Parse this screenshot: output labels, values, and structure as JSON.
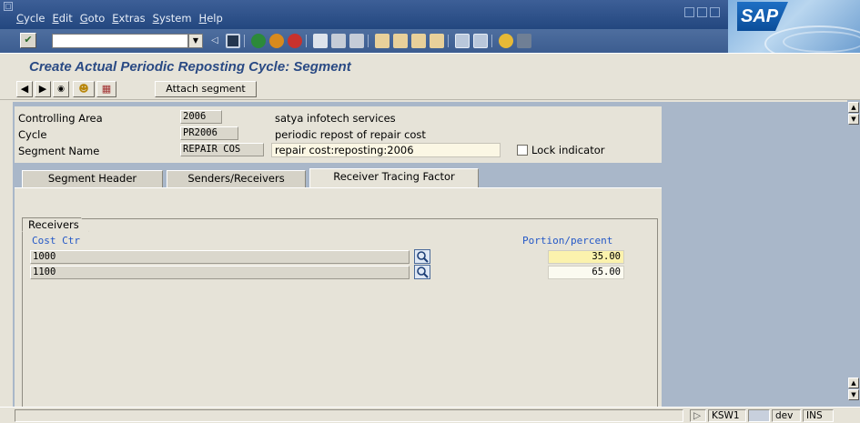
{
  "menu": [
    "Cycle",
    "Edit",
    "Goto",
    "Extras",
    "System",
    "Help"
  ],
  "logo": "SAP",
  "title": "Create Actual Periodic Reposting Cycle: Segment",
  "app_toolbar": {
    "attach_label": "Attach segment"
  },
  "header": {
    "controlling_area": {
      "label": "Controlling Area",
      "value": "2006",
      "desc": "satya infotech  services"
    },
    "cycle": {
      "label": "Cycle",
      "value": "PR2006",
      "desc": "periodic repost of repair cost"
    },
    "segment_name": {
      "label": "Segment Name",
      "value": "REPAIR COS",
      "desc": "repair cost:reposting:2006"
    },
    "lock_indicator": {
      "label": "Lock indicator",
      "checked": false
    }
  },
  "tabs": [
    {
      "label": "Segment Header",
      "active": false
    },
    {
      "label": "Senders/Receivers",
      "active": false
    },
    {
      "label": "Receiver Tracing Factor",
      "active": true
    }
  ],
  "receivers": {
    "group_label": "Receivers",
    "col_cost_ctr": "Cost Ctr",
    "col_portion": "Portion/percent",
    "rows": [
      {
        "cost_ctr": "1000",
        "portion": "35.00"
      },
      {
        "cost_ctr": "1100",
        "portion": "65.00"
      }
    ]
  },
  "status": {
    "tcode": "KSW1",
    "system": "dev",
    "mode": "INS"
  }
}
